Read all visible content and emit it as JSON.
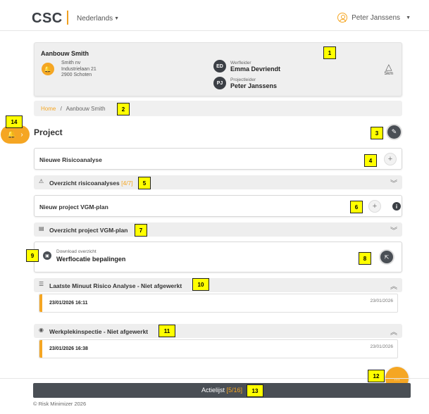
{
  "header": {
    "logo": "CSC",
    "language": "Nederlands",
    "user_name": "Peter Janssens"
  },
  "summary": {
    "title": "Aanbouw Smith",
    "address_lines": [
      "Smith nv",
      "Industrielaan 21",
      "2900 Schoten"
    ],
    "werfleider": {
      "initials": "ED",
      "role": "Werfleider",
      "name": "Emma Devriendt"
    },
    "projectleider": {
      "initials": "PJ",
      "role": "Projectleider",
      "name": "Peter Janssens"
    },
    "distance": "5km"
  },
  "breadcrumb": {
    "home": "Home",
    "separator": "/",
    "current": "Aanbouw Smith"
  },
  "project": {
    "title": "Project",
    "new_risk_analysis": "Nieuwe Risicoanalyse",
    "overview_risk_label": "Overzicht risicoanalyses",
    "overview_risk_count": "[4/7]",
    "new_vgm_plan": "Nieuw project VGM-plan",
    "overview_vgm_label": "Overzicht project VGM-plan",
    "download_sub": "Download overzicht",
    "download_main": "Werflocatie bepalingen",
    "lmra_title": "Laatste Minuut Risico Analyse - Niet afgewerkt",
    "lmra_entry": {
      "datetime": "23/01/2026 16:11",
      "date": "23/01/2026"
    },
    "inspection_title": "Werkplekinspectie - Niet afgewerkt",
    "inspection_entry": {
      "datetime": "23/01/2026 16:38",
      "date": "23/01/2026"
    }
  },
  "actionbar": {
    "label": "Actielijst",
    "count": "[5/16]"
  },
  "footer": {
    "copyright": "© Risk Minimizer 2026"
  },
  "fab": {
    "label": "..."
  },
  "markers": [
    "1",
    "2",
    "3",
    "4",
    "5",
    "6",
    "7",
    "8",
    "9",
    "10",
    "11",
    "12",
    "13",
    "14"
  ],
  "colors": {
    "accent": "#f5a623",
    "dark": "#4a4f55"
  }
}
